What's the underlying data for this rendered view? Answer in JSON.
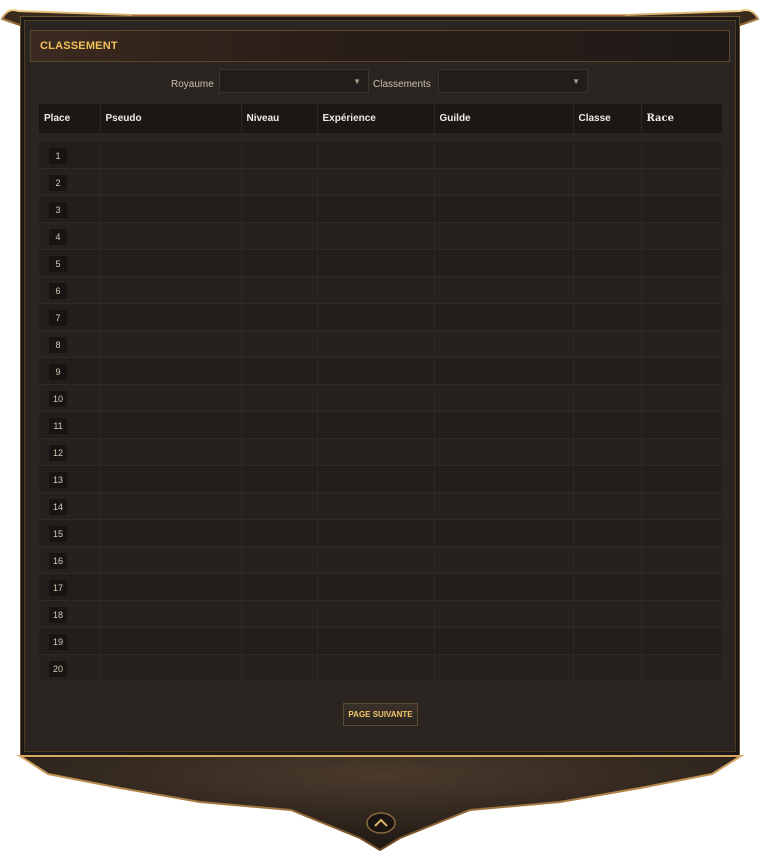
{
  "header": {
    "title": "CLASSEMENT"
  },
  "filters": {
    "realm_label": "Royaume",
    "realm_value": "",
    "ranking_label": "Classements",
    "ranking_value": ""
  },
  "table": {
    "columns": [
      "Place",
      "Pseudo",
      "Niveau",
      "Expérience",
      "Guilde",
      "Classe",
      "Race"
    ],
    "places": [
      "1",
      "2",
      "3",
      "4",
      "5",
      "6",
      "7",
      "8",
      "9",
      "10",
      "11",
      "12",
      "13",
      "14",
      "15",
      "16",
      "17",
      "18",
      "19",
      "20"
    ]
  },
  "footer": {
    "next_page_label": "PAGE SUIVANTE"
  },
  "icons": {
    "dropdown": "chevron-down-icon",
    "scroll_top": "chevron-up-icon"
  },
  "colors": {
    "accent": "#f2c15a",
    "panel": "#2a2521",
    "border": "#6b5232"
  }
}
